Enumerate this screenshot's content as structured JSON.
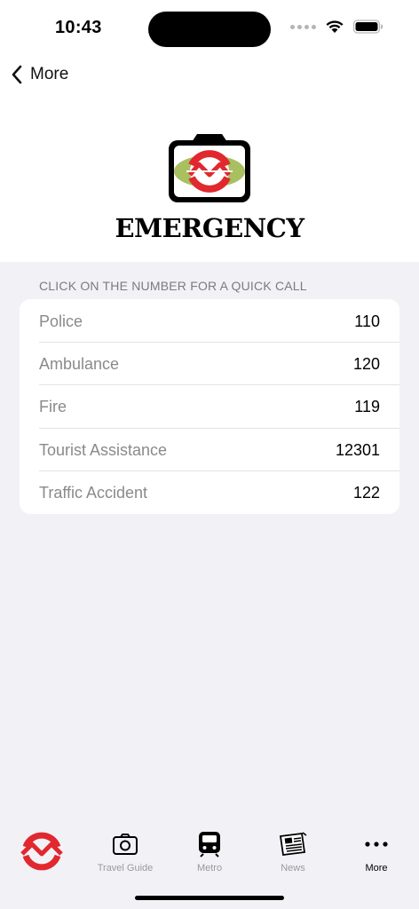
{
  "status": {
    "time": "10:43"
  },
  "nav": {
    "back_label": "More"
  },
  "header": {
    "title": "EMERGENCY"
  },
  "section": {
    "header": "CLICK ON THE NUMBER FOR A QUICK CALL"
  },
  "contacts": [
    {
      "name": "Police",
      "number": "110"
    },
    {
      "name": "Ambulance",
      "number": "120"
    },
    {
      "name": "Fire",
      "number": "119"
    },
    {
      "name": "Tourist Assistance",
      "number": "12301"
    },
    {
      "name": "Traffic Accident",
      "number": "122"
    }
  ],
  "tabs": [
    {
      "label": "Travel Guide",
      "icon": "camera-icon"
    },
    {
      "label": "Metro",
      "icon": "metro-train-icon"
    },
    {
      "label": "News",
      "icon": "newspaper-icon"
    },
    {
      "label": "More",
      "icon": "more-dots-icon"
    }
  ],
  "colors": {
    "brand_red": "#e0282e",
    "accent_green": "#a8c060",
    "active_tab": "#000000",
    "inactive_tab": "#9a9a9e"
  }
}
